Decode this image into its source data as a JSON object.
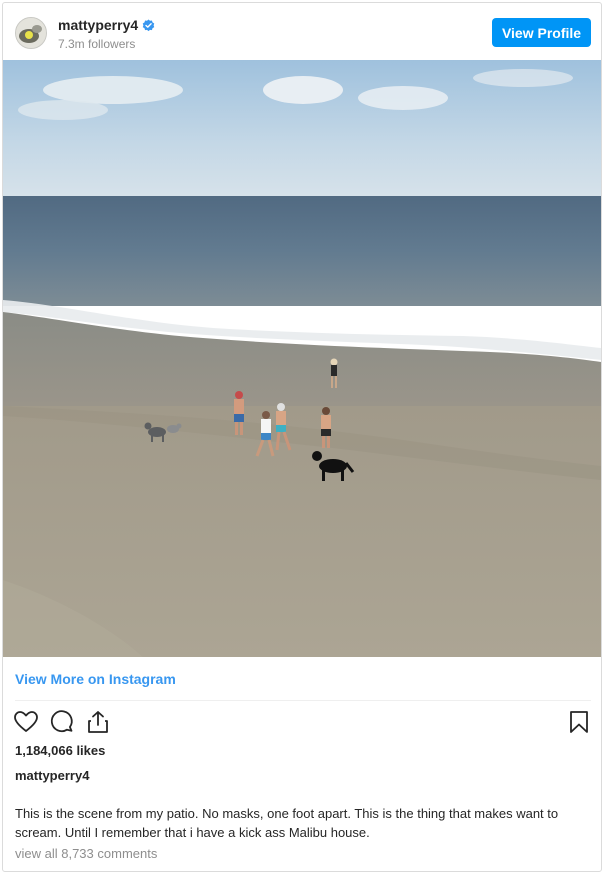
{
  "header": {
    "username": "mattyperry4",
    "verified": true,
    "followers": "7.3m followers",
    "view_profile_label": "View Profile"
  },
  "photo": {
    "subject": "beach scene"
  },
  "view_more_label": "View More on Instagram",
  "actions": {
    "like_icon": "heart-icon",
    "comment_icon": "comment-icon",
    "share_icon": "share-icon",
    "save_icon": "bookmark-icon"
  },
  "likes": "1,184,066 likes",
  "owner": "mattyperry4",
  "caption": "This is the scene from my patio. No masks, one foot apart. This is the thing that makes want to scream. Until I remember that i have a kick ass Malibu house.",
  "view_comments": "view all 8,733 comments",
  "colors": {
    "accent": "#0095f6",
    "link": "#3897f0",
    "text": "#262626",
    "muted": "#8e8e8e"
  }
}
